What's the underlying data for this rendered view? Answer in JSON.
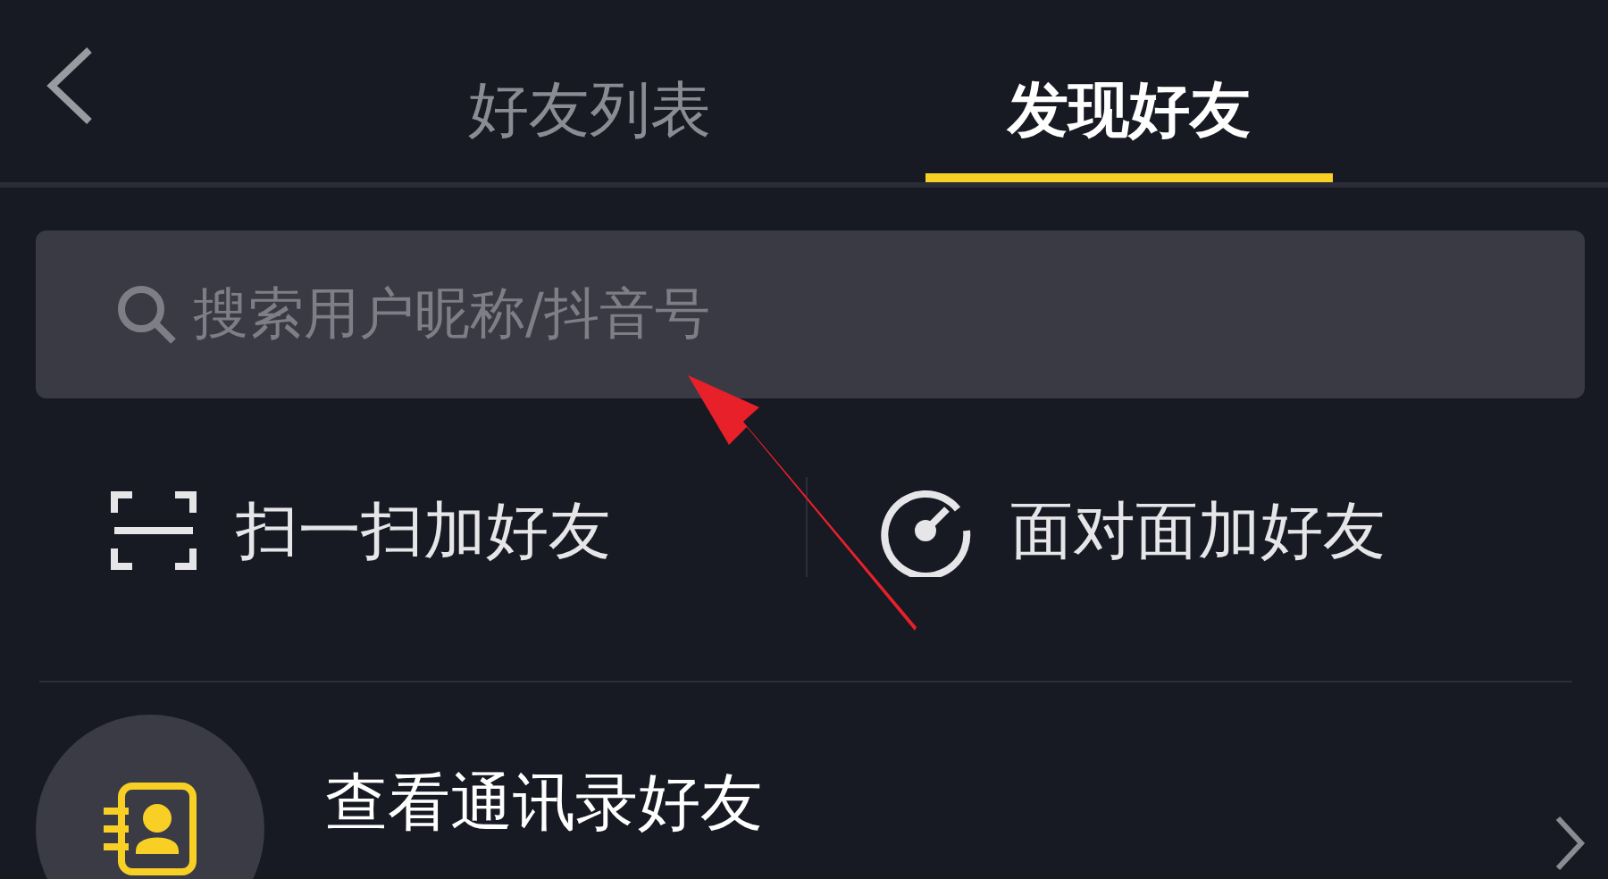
{
  "tabs": [
    {
      "label": "好友列表",
      "selected": false
    },
    {
      "label": "发现好友",
      "selected": true
    }
  ],
  "search": {
    "placeholder": "搜索用户昵称/抖音号"
  },
  "actions": [
    {
      "kind": "scan",
      "label": "扫一扫加好友"
    },
    {
      "kind": "face",
      "label": "面对面加好友"
    }
  ],
  "list": [
    {
      "title": "查看通讯录好友"
    }
  ]
}
